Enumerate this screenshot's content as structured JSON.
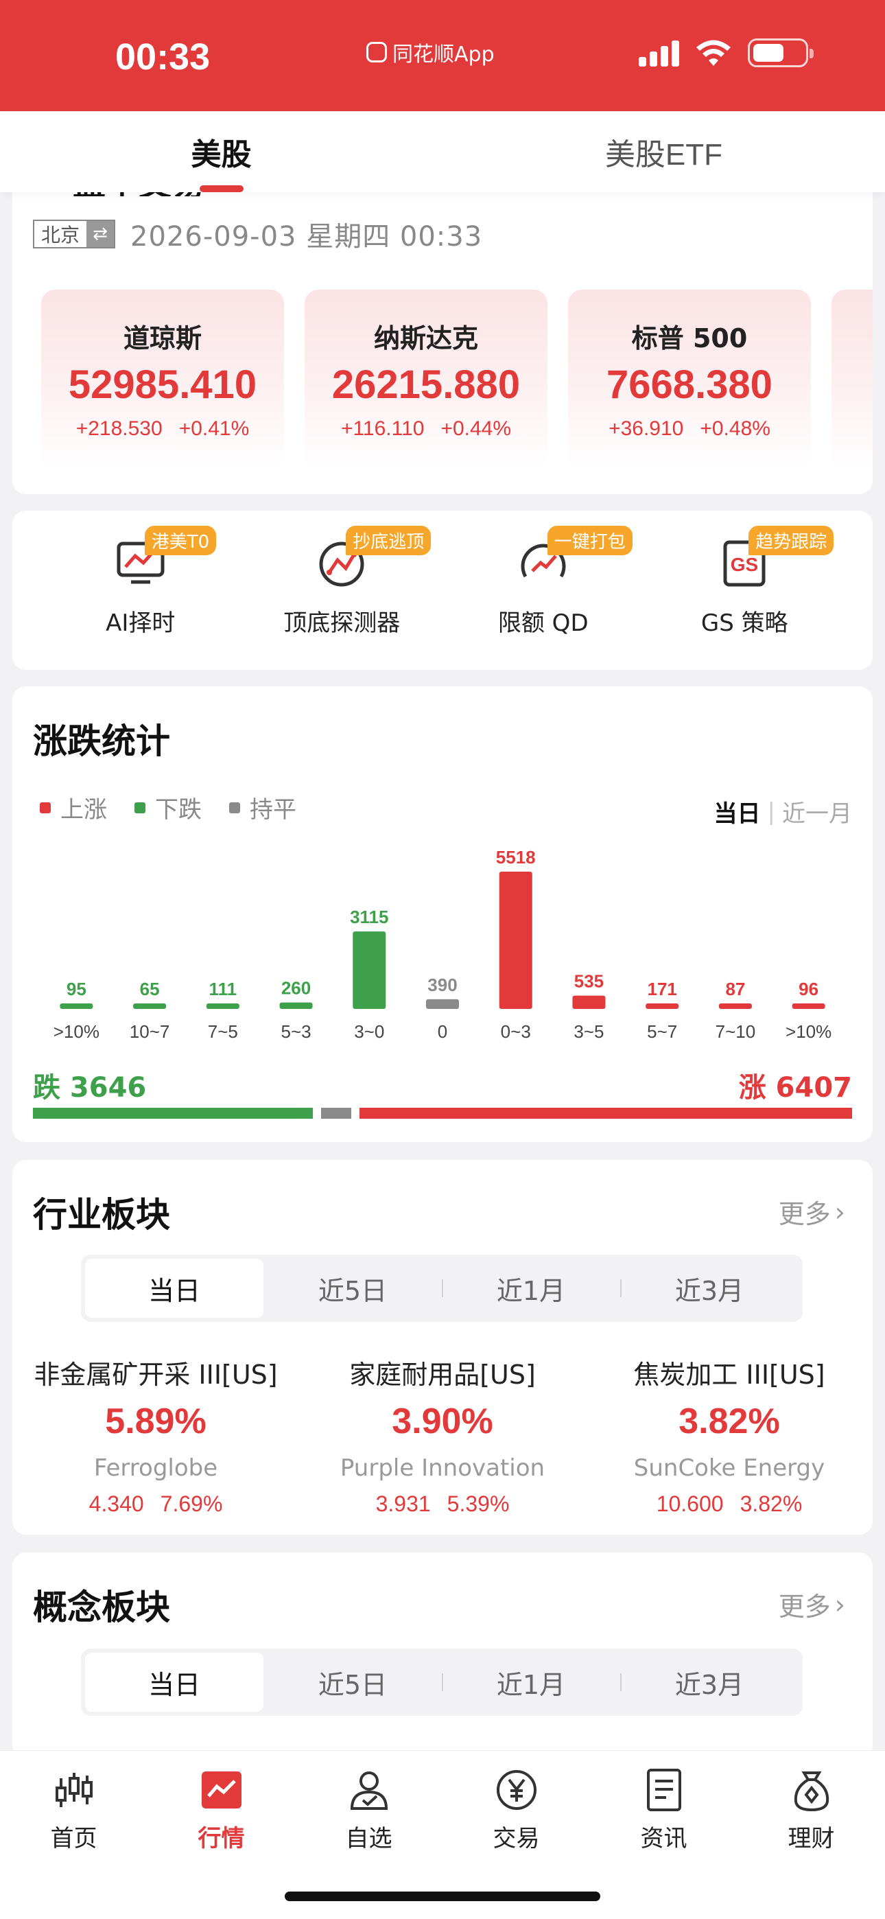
{
  "status_bar": {
    "time": "00:33",
    "app_label": "同花顺App"
  },
  "top_tabs": [
    {
      "label": "美股",
      "active": true
    },
    {
      "label": "美股ETF",
      "active": false
    }
  ],
  "market": {
    "peek_title": "盘中交易",
    "city": "北京",
    "swap_glyph": "⇄",
    "datetime": "2026-09-03 星期四  00:33",
    "indices": [
      {
        "name": "道琼斯",
        "value": "52985.410",
        "change": "+218.530",
        "pct": "+0.41%"
      },
      {
        "name": "纳斯达克",
        "value": "26215.880",
        "change": "+116.110",
        "pct": "+0.44%"
      },
      {
        "name": "标普 500",
        "value": "7668.380",
        "change": "+36.910",
        "pct": "+0.48%"
      }
    ]
  },
  "tools": [
    {
      "label": "AI择时",
      "badge": "港美T0",
      "icon": "chart-monitor-icon"
    },
    {
      "label": "顶底探测器",
      "badge": "抄底逃顶",
      "icon": "radar-trend-icon"
    },
    {
      "label": "限额 QD",
      "badge": "一键打包",
      "icon": "gauge-trend-icon"
    },
    {
      "label": "GS 策略",
      "badge": "趋势跟踪",
      "icon": "gs-doc-icon"
    }
  ],
  "stats": {
    "title": "涨跌统计",
    "legend": [
      {
        "label": "上涨",
        "color": "#e2393b"
      },
      {
        "label": "下跌",
        "color": "#3ea04a"
      },
      {
        "label": "持平",
        "color": "#8a8a8a"
      }
    ],
    "period_active": "当日",
    "period_inactive": "近一月",
    "total_down_label": "跌 3646",
    "total_up_label": "涨 6407",
    "ratio": {
      "down": 3646,
      "flat": 390,
      "up": 6407
    }
  },
  "chart_data": {
    "type": "bar",
    "categories": [
      ">10%",
      "10~7",
      "7~5",
      "5~3",
      "3~0",
      "0",
      "0~3",
      "3~5",
      "5~7",
      "7~10",
      ">10%"
    ],
    "values": [
      95,
      65,
      111,
      260,
      3115,
      390,
      5518,
      535,
      171,
      87,
      96
    ],
    "colors": [
      "#3ea04a",
      "#3ea04a",
      "#3ea04a",
      "#3ea04a",
      "#3ea04a",
      "#8a8a8a",
      "#e2393b",
      "#e2393b",
      "#e2393b",
      "#e2393b",
      "#e2393b"
    ],
    "title": "涨跌统计",
    "xlabel": "",
    "ylabel": "",
    "grid": false,
    "legend_position": "top-left"
  },
  "industry": {
    "title": "行业板块",
    "more": "更多",
    "tabs": [
      "当日",
      "近5日",
      "近1月",
      "近3月"
    ],
    "items": [
      {
        "name": "非金属矿开采 III[US]",
        "pct": "5.89%",
        "stock": "Ferroglobe",
        "price": "4.340",
        "stock_pct": "7.69%"
      },
      {
        "name": "家庭耐用品[US]",
        "pct": "3.90%",
        "stock": "Purple Innovation",
        "price": "3.931",
        "stock_pct": "5.39%"
      },
      {
        "name": "焦炭加工 III[US]",
        "pct": "3.82%",
        "stock": "SunCoke Energy",
        "price": "10.600",
        "stock_pct": "3.82%"
      }
    ]
  },
  "concept": {
    "title": "概念板块",
    "more": "更多",
    "tabs": [
      "当日",
      "近5日",
      "近1月",
      "近3月"
    ]
  },
  "bottom_nav": [
    {
      "label": "首页",
      "icon": "candlestick-icon",
      "active": false
    },
    {
      "label": "行情",
      "icon": "market-chart-icon",
      "active": true
    },
    {
      "label": "自选",
      "icon": "user-check-icon",
      "active": false
    },
    {
      "label": "交易",
      "icon": "yen-coin-icon",
      "active": false
    },
    {
      "label": "资讯",
      "icon": "news-doc-icon",
      "active": false
    },
    {
      "label": "理财",
      "icon": "money-bag-icon",
      "active": false
    }
  ]
}
